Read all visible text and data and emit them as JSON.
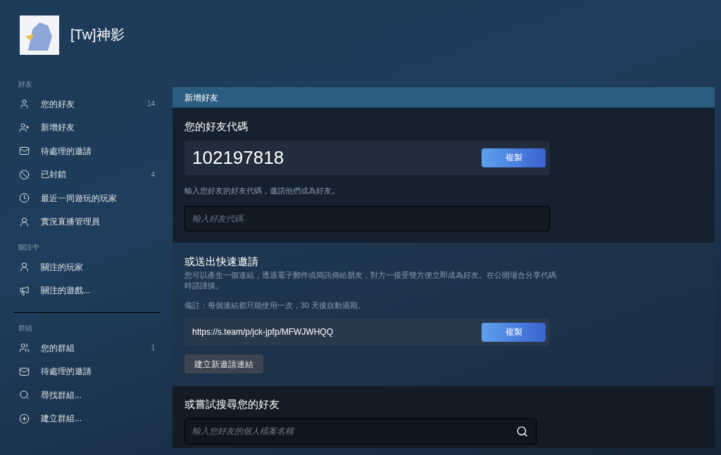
{
  "profile": {
    "name": "[Tw]神影"
  },
  "sidebar": [
    {
      "heading": "好友",
      "items": [
        {
          "label": "您的好友",
          "count": "14"
        },
        {
          "label": "新增好友"
        },
        {
          "label": "待處理的邀請"
        },
        {
          "label": "已封鎖",
          "count": "4"
        },
        {
          "label": "最近一同遊玩的玩家"
        },
        {
          "label": "實況直播管理員"
        }
      ]
    },
    {
      "heading": "關注中",
      "items": [
        {
          "label": "關注的玩家"
        },
        {
          "label": "關注的遊戲..."
        }
      ]
    },
    {
      "heading": "群組",
      "items": [
        {
          "label": "您的群組",
          "count": "1"
        },
        {
          "label": "待處理的邀請"
        },
        {
          "label": "尋找群組..."
        },
        {
          "label": "建立群組..."
        }
      ]
    }
  ],
  "panel": {
    "title": "新增好友",
    "friend_code": {
      "heading": "您的好友代碼",
      "code": "102197818",
      "copy_button": "複製",
      "hint": "輸入您好友的好友代碼，邀請他們成為好友。",
      "input_placeholder": "輸入好友代碼"
    },
    "quick_invite": {
      "heading": "或送出快速邀請",
      "description": "您可以產生一個連結，透過電子郵件或簡訊傳給朋友，對方一接受雙方便立即成為好友。在公開場合分享代碼時請謹慎。",
      "note": "備註：每個連結都只能使用一次，30 天後自動過期。",
      "link": "https://s.team/p/jck-jpfp/MFWJWHQQ",
      "copy_button": "複製",
      "create_button": "建立新邀請連結"
    },
    "search": {
      "heading": "或嘗試搜尋您的好友",
      "placeholder": "輸入您好友的個人檔案名稱"
    }
  }
}
